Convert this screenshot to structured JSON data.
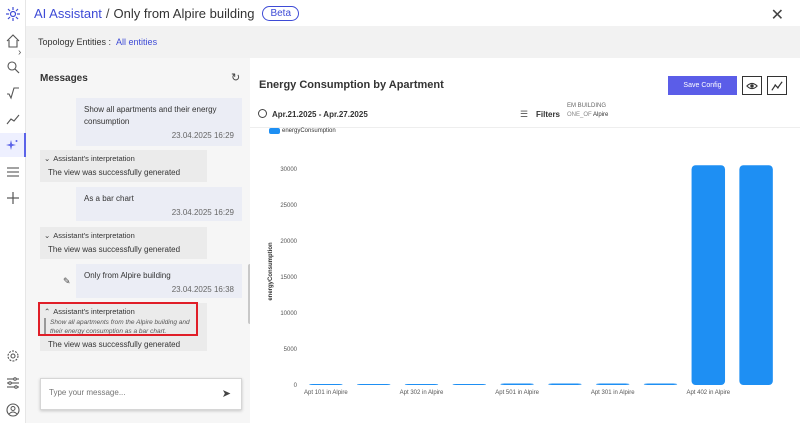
{
  "header": {
    "app_name": "AI Assistant",
    "separator": "/",
    "view_title": "Only from Alpire building",
    "badge": "Beta",
    "close_icon": "close-icon"
  },
  "topology": {
    "label": "Topology Entities :",
    "value": "All entities"
  },
  "rail": {
    "icons": [
      "home-icon",
      "search-icon",
      "formula-icon",
      "trend-icon",
      "ai-sparkle-icon",
      "menu-icon",
      "plus-icon",
      "settings-icon",
      "sliders-icon",
      "user-icon"
    ],
    "active": "ai-sparkle-icon"
  },
  "messages": {
    "title": "Messages",
    "items": [
      {
        "type": "user",
        "text": "Show all apartments and their energy consumption",
        "time": "23.04.2025 16:29"
      },
      {
        "type": "assistant",
        "header": "Assistant's interpretation",
        "status": "The view was successfully generated"
      },
      {
        "type": "user",
        "text": "As a bar chart",
        "time": "23.04.2025 16:29"
      },
      {
        "type": "assistant",
        "header": "Assistant's interpretation",
        "status": "The view was successfully generated"
      },
      {
        "type": "user",
        "text": "Only from Alpire building",
        "time": "23.04.2025 16:38"
      },
      {
        "type": "assistant",
        "header": "Assistant's interpretation",
        "interpretation": "Show all apartments from the Alpire building and their energy consumption as a bar chart.",
        "status": "The view was successfully generated"
      }
    ],
    "composer_placeholder": "Type your message..."
  },
  "chart_panel": {
    "title": "Energy Consumption by Apartment",
    "save_label": "Save Config",
    "date_range": "Apr.21.2025 - Apr.27.2025",
    "filters_label": "Filters",
    "filter": {
      "name": "EM BUILDING",
      "op": "ONE_OF",
      "value": "Alpire"
    }
  },
  "colors": {
    "accent": "#5b5de8",
    "bar": "#1e8ff3",
    "highlight": "#e01e28"
  },
  "chart_data": {
    "type": "bar",
    "ylabel": "energyConsumption",
    "xlabel": "",
    "legend": [
      "energyConsumption"
    ],
    "ylim": [
      0,
      30000
    ],
    "yticks": [
      0,
      5000,
      10000,
      15000,
      20000,
      25000,
      30000
    ],
    "categories": [
      "Apt 101 in Alpire",
      "",
      "Apt 302 in Alpire",
      "",
      "Apt 501 in Alpire",
      "",
      "Apt 301 in Alpire",
      "",
      "Apt 402 in Alpire",
      ""
    ],
    "values": [
      0,
      0,
      0,
      0,
      200,
      200,
      200,
      200,
      30500,
      30500
    ]
  }
}
